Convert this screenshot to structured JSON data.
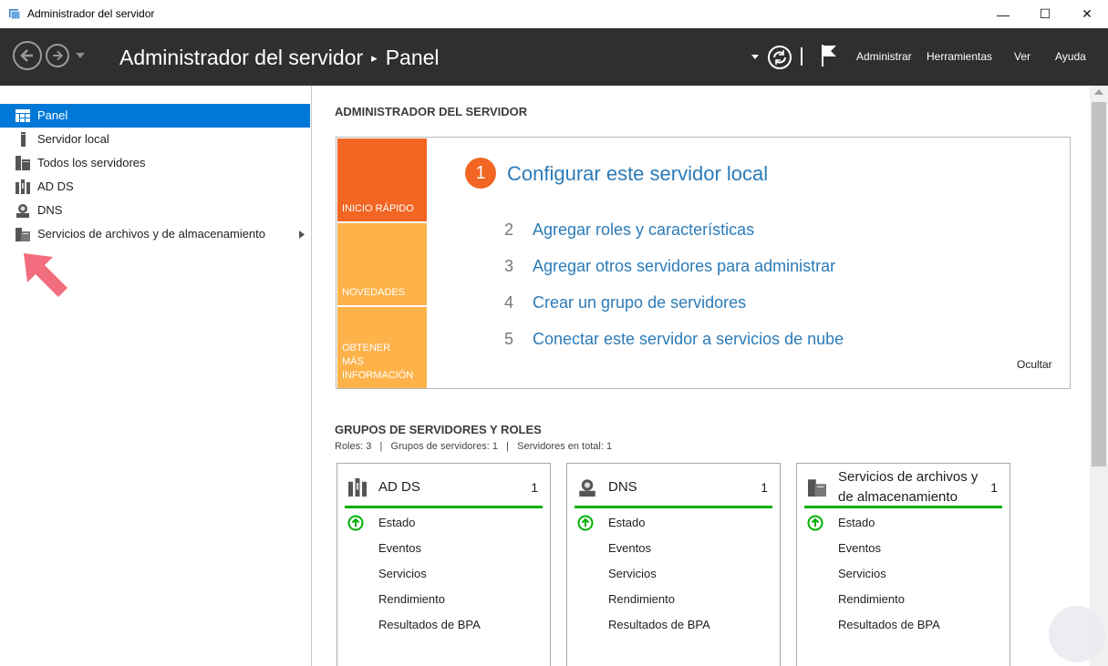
{
  "window": {
    "title": "Administrador del servidor",
    "controls": {
      "minimize": "—",
      "maximize": "☐",
      "close": "✕"
    }
  },
  "header": {
    "breadcrumb_app": "Administrador del servidor",
    "breadcrumb_page": "Panel",
    "menus": [
      "Administrar",
      "Herramientas",
      "Ver",
      "Ayuda"
    ]
  },
  "sidebar": {
    "items": [
      {
        "label": "Panel",
        "icon": "dashboard-icon",
        "selected": true
      },
      {
        "label": "Servidor local",
        "icon": "server-icon"
      },
      {
        "label": "Todos los servidores",
        "icon": "servers-icon"
      },
      {
        "label": "AD DS",
        "icon": "adds-icon"
      },
      {
        "label": "DNS",
        "icon": "dns-icon"
      },
      {
        "label": "Servicios de archivos y de almacenamiento",
        "icon": "file-storage-icon"
      }
    ]
  },
  "main": {
    "section_title": "ADMINISTRADOR DEL SERVIDOR",
    "quick_start": {
      "tiles": [
        {
          "label": "INICIO RÁPIDO",
          "color": "#f26522"
        },
        {
          "label": "NOVEDADES",
          "color": "#fdb24a"
        },
        {
          "label": "OBTENER MÁS INFORMACIÓN",
          "color": "#fdb24a"
        }
      ],
      "primary_step": {
        "number": "1",
        "text": "Configurar este servidor local"
      },
      "steps": [
        {
          "number": "2",
          "text": "Agregar roles y características"
        },
        {
          "number": "3",
          "text": "Agregar otros servidores para administrar"
        },
        {
          "number": "4",
          "text": "Crear un grupo de servidores"
        },
        {
          "number": "5",
          "text": "Conectar este servidor a servicios de nube"
        }
      ],
      "hide_link": "Ocultar"
    },
    "groups": {
      "title": "GRUPOS DE SERVIDORES Y ROLES",
      "summary": "Roles: 3   |   Grupos de servidores: 1   |   Servidores en total: 1",
      "cards": [
        {
          "title": "AD DS",
          "count": "1",
          "icon": "adds-icon",
          "rows": [
            "Estado",
            "Eventos",
            "Servicios",
            "Rendimiento",
            "Resultados de BPA"
          ]
        },
        {
          "title": "DNS",
          "count": "1",
          "icon": "dns-icon",
          "rows": [
            "Estado",
            "Eventos",
            "Servicios",
            "Rendimiento",
            "Resultados de BPA"
          ]
        },
        {
          "title": "Servicios de archivos y de almacenamiento",
          "count": "1",
          "icon": "file-storage-icon",
          "rows": [
            "Estado",
            "Eventos",
            "Servicios",
            "Rendimiento",
            "Resultados de BPA"
          ]
        }
      ]
    }
  },
  "colors": {
    "accent": "#0078d7",
    "header_bg": "#2f2f2f",
    "link": "#2b7bb9",
    "status_ok": "#00b000",
    "arrow": "#f26d7d"
  }
}
